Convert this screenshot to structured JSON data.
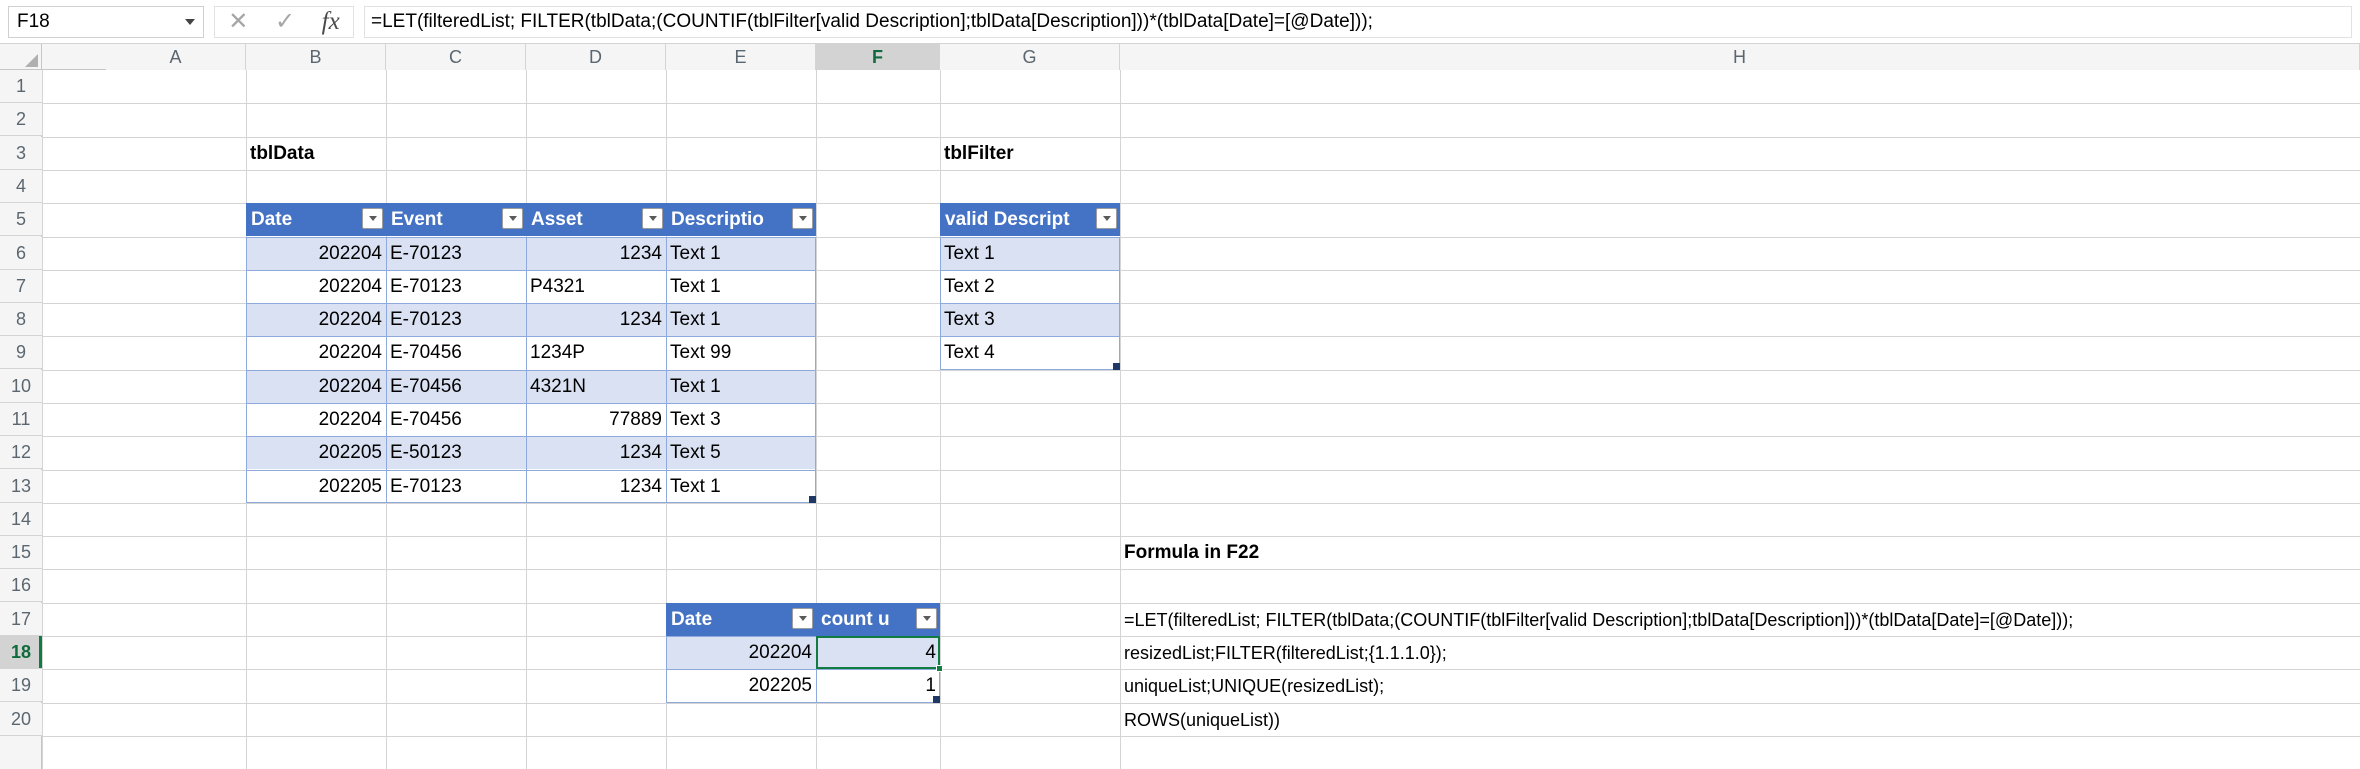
{
  "formula_bar": {
    "name_box": "F18",
    "cancel_icon": "cancel-icon",
    "confirm_icon": "confirm-icon",
    "function_icon": "fx-icon",
    "formula": "=LET(filteredList; FILTER(tblData;(COUNTIF(tblFilter[valid Description];tblData[Description]))*(tblData[Date]=[@Date]));"
  },
  "grid": {
    "columns": [
      "A",
      "B",
      "C",
      "D",
      "E",
      "F",
      "G",
      "H"
    ],
    "selected_column": "F",
    "rows": [
      "1",
      "2",
      "3",
      "4",
      "5",
      "6",
      "7",
      "8",
      "9",
      "10",
      "11",
      "12",
      "13",
      "14",
      "15",
      "16",
      "17",
      "18",
      "19",
      "20"
    ],
    "selected_row": "18"
  },
  "tbl_data": {
    "title": "tblData",
    "headers": [
      "Date",
      "Event",
      "Asset",
      "Descriptio"
    ],
    "rows": [
      {
        "date": "202204",
        "event": "E-70123",
        "asset": "1234",
        "asset_align": "right",
        "description": "Text 1"
      },
      {
        "date": "202204",
        "event": "E-70123",
        "asset": "P4321",
        "asset_align": "left",
        "description": "Text 1"
      },
      {
        "date": "202204",
        "event": "E-70123",
        "asset": "1234",
        "asset_align": "right",
        "description": "Text 1"
      },
      {
        "date": "202204",
        "event": "E-70456",
        "asset": "1234P",
        "asset_align": "left",
        "description": "Text 99"
      },
      {
        "date": "202204",
        "event": "E-70456",
        "asset": "4321N",
        "asset_align": "left",
        "description": "Text 1"
      },
      {
        "date": "202204",
        "event": "E-70456",
        "asset": "77889",
        "asset_align": "right",
        "description": "Text 3"
      },
      {
        "date": "202205",
        "event": "E-50123",
        "asset": "1234",
        "asset_align": "right",
        "description": "Text 5"
      },
      {
        "date": "202205",
        "event": "E-70123",
        "asset": "1234",
        "asset_align": "right",
        "description": "Text 1"
      }
    ]
  },
  "tbl_filter": {
    "title": "tblFilter",
    "header": "valid Descript",
    "rows": [
      "Text 1",
      "Text 2",
      "Text 3",
      "Text 4"
    ]
  },
  "tbl_summary": {
    "headers": [
      "Date",
      "count u"
    ],
    "rows": [
      {
        "date": "202204",
        "count": "4"
      },
      {
        "date": "202205",
        "count": "1"
      }
    ]
  },
  "notes": {
    "heading": "Formula in F22",
    "lines": [
      "=LET(filteredList; FILTER(tblData;(COUNTIF(tblFilter[valid Description];tblData[Description]))*(tblData[Date]=[@Date]));",
      "resizedList;FILTER(filteredList;{1.1.1.0});",
      "uniqueList;UNIQUE(resizedList);",
      "ROWS(uniqueList))"
    ]
  },
  "colors": {
    "table_header": "#4472c4",
    "band": "#d9e1f2",
    "table_border": "#8ea9db",
    "selection": "#107c41"
  }
}
